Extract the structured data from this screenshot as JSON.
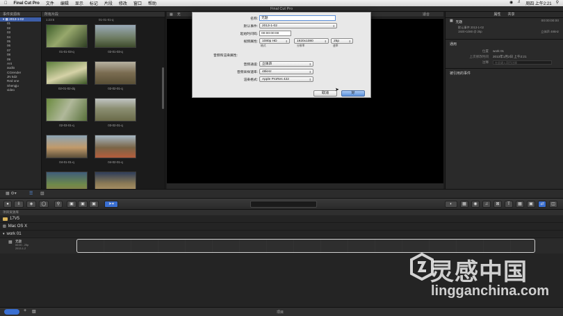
{
  "menubar": {
    "app_name": "Final Cut Pro",
    "items": [
      "文件",
      "编辑",
      "显示",
      "标记",
      "片段",
      "修改",
      "窗口",
      "帮助"
    ],
    "clock": "周四 上午2:21"
  },
  "window": {
    "title": "Final Cut Pro"
  },
  "library": {
    "header": "事件资源库",
    "items": [
      "2013-1-02",
      "01",
      "02",
      "03",
      "04",
      "05",
      "06",
      "07",
      "08",
      "09",
      "Ant",
      "audio",
      "CGrender",
      "JN 5d2",
      "Red one",
      "Shengju",
      "video"
    ]
  },
  "browser": {
    "header": "所有片段",
    "subheader_left": "1:23:5",
    "subheader_right": "01-01-01-q",
    "clips": [
      "01-01-03-q",
      "02-01-03-q",
      "02-01-02-dq",
      "02-02-01-q",
      "02-03-01-q",
      "03-02-01-q",
      "04-01-01-q",
      "04-02-01-q",
      "",
      ""
    ]
  },
  "viewer": {
    "header": "无",
    "zoom": "适合"
  },
  "inspector": {
    "tabs": [
      "属性",
      "共享"
    ],
    "project_name": "无题",
    "timecode": "00:00:00:00",
    "default_event_label": "默认事件",
    "default_event": "2013-1-02",
    "format": "1920×1080 @ 25p",
    "audio": "立体声 48kHz",
    "section_general": "通用",
    "location_label": "位置",
    "location": "work 01",
    "modified_label": "上次修改时间",
    "modified": "2013年1月2日 上午2:21",
    "notes_label": "注释",
    "notes_placeholder": "在此键入项目注释",
    "section_refs": "被引用的事件"
  },
  "dialog": {
    "name_label": "名称:",
    "name_value": "无题",
    "event_label": "默认事件:",
    "event_value": "2013-1-02",
    "start_tc_label": "起始时间码:",
    "start_tc_value": "00:00:00:00",
    "video_label": "视频属性:",
    "video_format": "1080p HD",
    "video_resolution": "1920x1080",
    "video_rate": "25p",
    "video_format_sub": "格式",
    "video_resolution_sub": "分辨率",
    "video_rate_sub": "速率",
    "audio_section": "音频和渲染属性:",
    "audio_channels_label": "音频通道:",
    "audio_channels_value": "立体声",
    "sample_rate_label": "音频采样速率:",
    "sample_rate_value": "48kHz",
    "render_label": "渲染格式:",
    "render_value": "Apple ProRes 422",
    "cancel_label": "取消",
    "ok_label": "好"
  },
  "timeline": {
    "header": "项目资源库",
    "rows": [
      "17V5",
      "Mac OS X",
      "work 01"
    ],
    "project_title": "无题",
    "project_meta1": "00:00 - 25p",
    "project_meta2": "2013-1-2",
    "status": "项目"
  },
  "watermark": {
    "cn": "灵感中国",
    "en": "lingganchina.com"
  }
}
